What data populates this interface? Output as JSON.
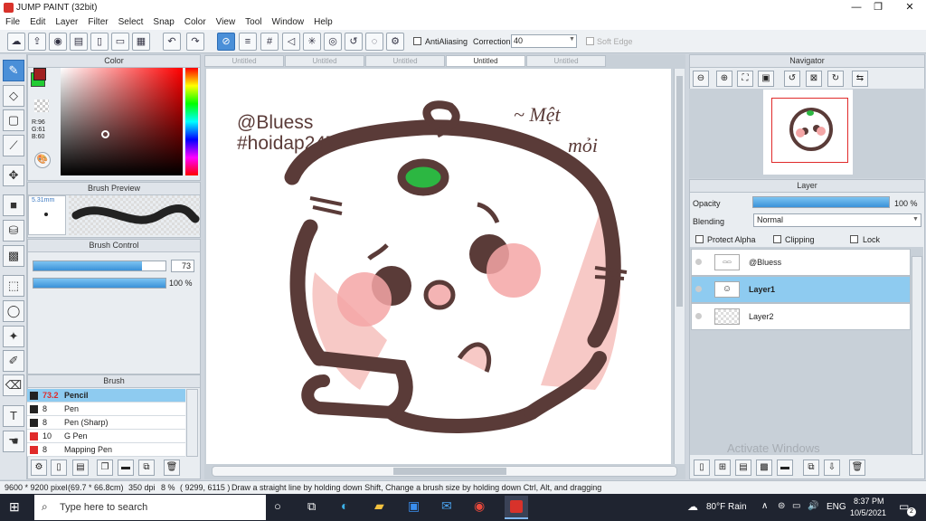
{
  "window": {
    "title": "JUMP PAINT (32bit)",
    "min": "—",
    "max": "❐",
    "close": "✕"
  },
  "menu": [
    "File",
    "Edit",
    "Layer",
    "Filter",
    "Select",
    "Snap",
    "Color",
    "View",
    "Tool",
    "Window",
    "Help"
  ],
  "toolbar": {
    "antialiasing_label": "AntiAliasing",
    "correction_label": "Correction",
    "correction_value": "40",
    "softedge_label": "Soft Edge"
  },
  "color_panel": {
    "title": "Color",
    "r": "R:96",
    "g": "G:61",
    "b": "B:60",
    "fg": "#603d3c",
    "bg": "#22cc33"
  },
  "brush_preview": {
    "title": "Brush Preview",
    "size": "5.31mm"
  },
  "brush_control": {
    "title": "Brush Control",
    "size_value": "73",
    "opacity_value": "100 %"
  },
  "brush_panel": {
    "title": "Brush",
    "items": [
      {
        "size": "73.2",
        "name": "Pencil",
        "color": "#222222"
      },
      {
        "size": "8",
        "name": "Pen",
        "color": "#222222"
      },
      {
        "size": "8",
        "name": "Pen (Sharp)",
        "color": "#222222"
      },
      {
        "size": "10",
        "name": "G Pen",
        "color": "#e02a2a"
      },
      {
        "size": "8",
        "name": "Mapping Pen",
        "color": "#e02a2a"
      }
    ]
  },
  "doc_tabs": [
    "Untitled",
    "Untitled",
    "Untitled",
    "Untitled",
    "Untitled"
  ],
  "artwork": {
    "line1": "@Bluess",
    "line2": "#hoidap247",
    "text1": "~ Mệt",
    "text2": "mỏi"
  },
  "navigator": {
    "title": "Navigator"
  },
  "layer_panel": {
    "title": "Layer",
    "opacity_label": "Opacity",
    "opacity_value": "100 %",
    "blending_label": "Blending",
    "blending_value": "Normal",
    "protect_alpha": "Protect Alpha",
    "clipping": "Clipping",
    "lock": "Lock",
    "layers": [
      "@Bluess",
      "Layer1",
      "Layer2"
    ]
  },
  "watermark": "Activate Windows",
  "status": {
    "size": "9600 * 9200 pixel",
    "mm": "(69.7 * 66.8cm)",
    "dpi": "350 dpi",
    "zoom": "8 %",
    "coords": "( 9299, 6115 )",
    "hint": "Draw a straight line by holding down Shift, Change a brush size by holding down Ctrl, Alt, and dragging"
  },
  "taskbar": {
    "search": "Type here to search",
    "weather": "80°F Rain",
    "lang": "ENG",
    "time": "8:37 PM",
    "date": "10/5/2021",
    "notifications": "2"
  }
}
